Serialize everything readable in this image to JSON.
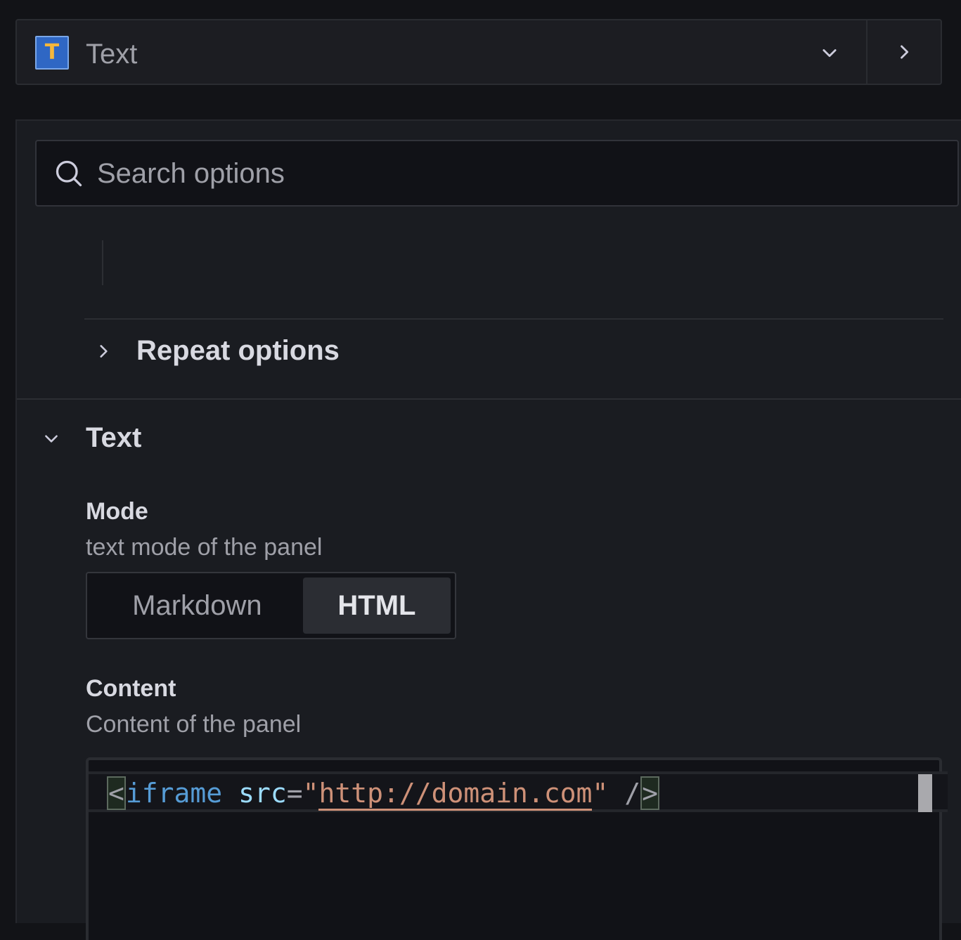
{
  "header": {
    "visualization": {
      "icon_letter": "T",
      "title": "Text",
      "dropdown_icon": "chevron-down-icon",
      "expand_icon": "chevron-right-icon"
    }
  },
  "search": {
    "placeholder": "Search options",
    "value": ""
  },
  "sections": {
    "repeat": {
      "label": "Repeat options",
      "expanded": false
    },
    "text": {
      "label": "Text",
      "expanded": true,
      "mode": {
        "label": "Mode",
        "description": "text mode of the panel",
        "options": [
          "Markdown",
          "HTML"
        ],
        "selected": "HTML"
      },
      "content": {
        "label": "Content",
        "description": "Content of the panel",
        "code": {
          "open_bracket": "<",
          "tag": "iframe",
          "attr": "src",
          "equals": "=",
          "quote_open": "\"",
          "url": "http://domain.com",
          "quote_close": "\"",
          "self_close": " /",
          "close_bracket": ">"
        }
      }
    }
  },
  "colors": {
    "background": "#121317",
    "panel": "#1a1c21",
    "accent_icon_bg": "#2f67c4",
    "accent_icon_letter": "#f5b73b",
    "code_tag": "#569cd6",
    "code_attr": "#9cdcfe",
    "code_string": "#ce9178"
  }
}
